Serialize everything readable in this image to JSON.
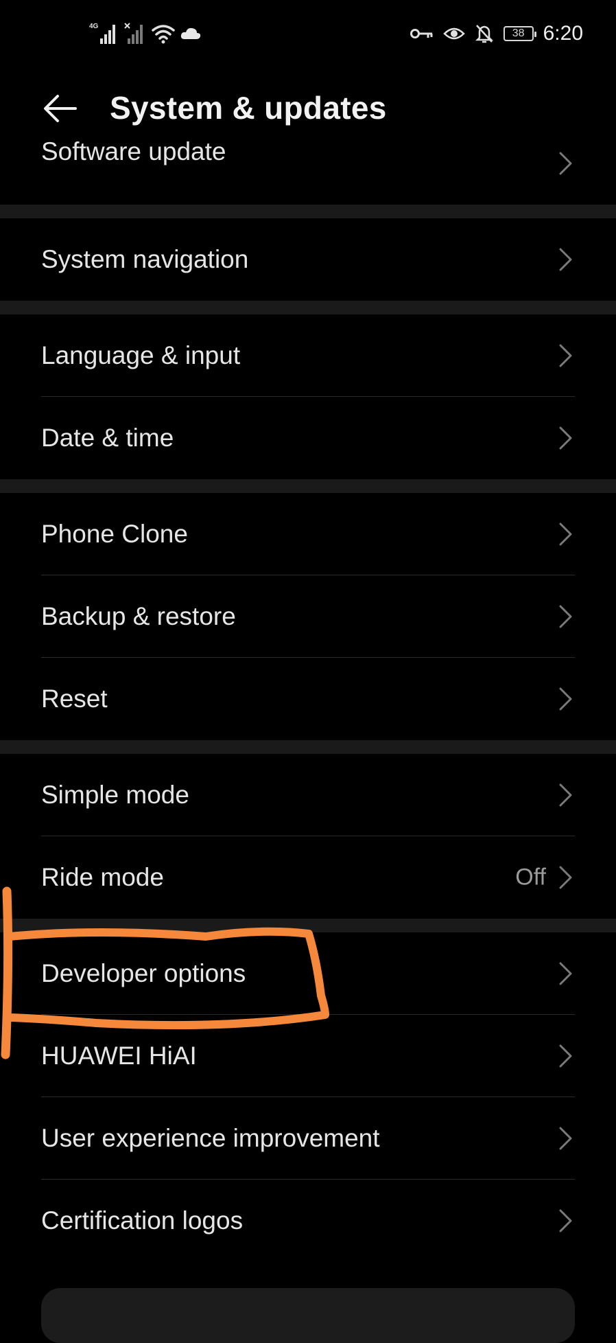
{
  "status": {
    "network": "4G",
    "battery": "38",
    "time": "6:20"
  },
  "header": {
    "title": "System & updates"
  },
  "sections": [
    [
      {
        "label": "Software update",
        "value": ""
      }
    ],
    [
      {
        "label": "System navigation",
        "value": ""
      }
    ],
    [
      {
        "label": "Language & input",
        "value": ""
      },
      {
        "label": "Date & time",
        "value": ""
      }
    ],
    [
      {
        "label": "Phone Clone",
        "value": ""
      },
      {
        "label": "Backup & restore",
        "value": ""
      },
      {
        "label": "Reset",
        "value": ""
      }
    ],
    [
      {
        "label": "Simple mode",
        "value": ""
      },
      {
        "label": "Ride mode",
        "value": "Off"
      }
    ],
    [
      {
        "label": "Developer options",
        "value": ""
      },
      {
        "label": "HUAWEI HiAI",
        "value": ""
      },
      {
        "label": "User experience improvement",
        "value": ""
      },
      {
        "label": "Certification logos",
        "value": ""
      }
    ]
  ],
  "colors": {
    "background": "#000000",
    "section_gap": "#1a1a1a",
    "annotation": "#f5883a"
  }
}
